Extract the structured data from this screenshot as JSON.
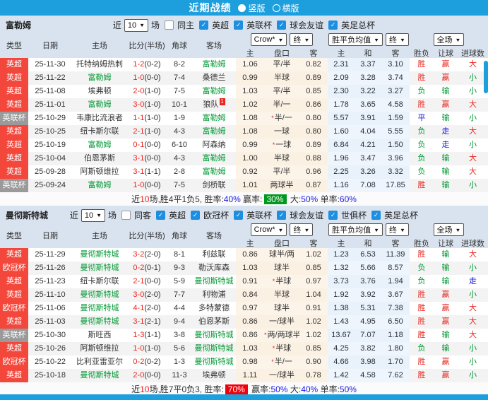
{
  "colors": {
    "accent_blue": "#1d9fdd",
    "badge_red": "#f4473c",
    "badge_gray": "#9a9a9a",
    "team_green": "#009933",
    "score_red": "#e8251f",
    "link_blue": "#1a1ae6",
    "box_green": "#00991f",
    "box_red": "#f2000c",
    "odds_bg": "#fcf4e9",
    "avg_bg": "#e9f2fb"
  },
  "titlebar": {
    "title": "近期战绩",
    "radios": [
      {
        "label": "竖版",
        "selected": true
      },
      {
        "label": "横版",
        "selected": false
      }
    ]
  },
  "columns": {
    "left": [
      "类型",
      "日期",
      "主场",
      "比分(半场)",
      "角球",
      "客场"
    ],
    "odds_sub": [
      "主",
      "盘口",
      "客"
    ],
    "avg_sub": [
      "主",
      "和",
      "客"
    ],
    "results": [
      "胜负",
      "让球",
      "进球数"
    ]
  },
  "controls": {
    "recent_prefix": "近",
    "recent_count": "10",
    "recent_suffix": "场",
    "odds_company": "Crow*",
    "odds_final": "终",
    "avg_label": "胜平负均值",
    "avg_final": "终",
    "scope": "全场"
  },
  "tables": [
    {
      "team": "富勒姆",
      "same_label": "同主",
      "same_checked": false,
      "leagues": [
        "英超",
        "英联杯",
        "球会友谊",
        "英足总杯"
      ],
      "rows": [
        {
          "lg": "英超",
          "lgc": "red",
          "date": "25-11-30",
          "home": "托特纳姆热刺",
          "hT": false,
          "ft": "1-2",
          "ht": "(0-2)",
          "cn": "8-2",
          "away": "富勒姆",
          "aT": true,
          "bd": "",
          "o1": "1.06",
          "st": false,
          "hd": "平/半",
          "o2": "0.82",
          "m1": "2.31",
          "m2": "3.37",
          "m3": "3.10",
          "r1": "胜",
          "c1": "red",
          "r2": "赢",
          "c2": "red",
          "r3": "大",
          "c3": "red"
        },
        {
          "lg": "英超",
          "lgc": "red",
          "date": "25-11-22",
          "home": "富勒姆",
          "hT": true,
          "ft": "1-0",
          "ht": "(0-0)",
          "cn": "7-4",
          "away": "桑德兰",
          "aT": false,
          "bd": "",
          "o1": "0.99",
          "st": false,
          "hd": "半球",
          "o2": "0.89",
          "m1": "2.09",
          "m2": "3.28",
          "m3": "3.74",
          "r1": "胜",
          "c1": "red",
          "r2": "赢",
          "c2": "red",
          "r3": "小",
          "c3": "green"
        },
        {
          "lg": "英超",
          "lgc": "red",
          "date": "25-11-08",
          "home": "埃弗顿",
          "hT": false,
          "ft": "2-0",
          "ht": "(1-0)",
          "cn": "7-5",
          "away": "富勒姆",
          "aT": true,
          "bd": "",
          "o1": "1.03",
          "st": false,
          "hd": "平/半",
          "o2": "0.85",
          "m1": "2.30",
          "m2": "3.22",
          "m3": "3.27",
          "r1": "负",
          "c1": "green",
          "r2": "输",
          "c2": "green",
          "r3": "小",
          "c3": "green"
        },
        {
          "lg": "英超",
          "lgc": "red",
          "date": "25-11-01",
          "home": "富勒姆",
          "hT": true,
          "ft": "3-0",
          "ht": "(1-0)",
          "cn": "10-1",
          "away": "狼队",
          "aT": false,
          "bd": "1",
          "o1": "1.02",
          "st": false,
          "hd": "半/一",
          "o2": "0.86",
          "m1": "1.78",
          "m2": "3.65",
          "m3": "4.58",
          "r1": "胜",
          "c1": "red",
          "r2": "赢",
          "c2": "red",
          "r3": "大",
          "c3": "red"
        },
        {
          "lg": "英联杯",
          "lgc": "gray",
          "date": "25-10-29",
          "home": "韦康比流浪者",
          "hT": false,
          "ft": "1-1",
          "ht": "(1-0)",
          "cn": "1-9",
          "away": "富勒姆",
          "aT": true,
          "bd": "",
          "o1": "1.08",
          "st": true,
          "hd": "半/一",
          "o2": "0.80",
          "m1": "5.57",
          "m2": "3.91",
          "m3": "1.59",
          "r1": "平",
          "c1": "blue",
          "r2": "输",
          "c2": "green",
          "r3": "小",
          "c3": "green"
        },
        {
          "lg": "英超",
          "lgc": "red",
          "date": "25-10-25",
          "home": "纽卡斯尔联",
          "hT": false,
          "ft": "2-1",
          "ht": "(1-0)",
          "cn": "4-3",
          "away": "富勒姆",
          "aT": true,
          "bd": "",
          "o1": "1.08",
          "st": false,
          "hd": "一球",
          "o2": "0.80",
          "m1": "1.60",
          "m2": "4.04",
          "m3": "5.55",
          "r1": "负",
          "c1": "green",
          "r2": "走",
          "c2": "blue",
          "r3": "大",
          "c3": "red"
        },
        {
          "lg": "英超",
          "lgc": "red",
          "date": "25-10-19",
          "home": "富勒姆",
          "hT": true,
          "ft": "0-1",
          "ht": "(0-0)",
          "cn": "6-10",
          "away": "阿森纳",
          "aT": false,
          "bd": "",
          "o1": "0.99",
          "st": true,
          "hd": "一球",
          "o2": "0.89",
          "m1": "6.84",
          "m2": "4.21",
          "m3": "1.50",
          "r1": "负",
          "c1": "green",
          "r2": "走",
          "c2": "blue",
          "r3": "小",
          "c3": "green"
        },
        {
          "lg": "英超",
          "lgc": "red",
          "date": "25-10-04",
          "home": "伯恩茅斯",
          "hT": false,
          "ft": "3-1",
          "ht": "(0-0)",
          "cn": "4-3",
          "away": "富勒姆",
          "aT": true,
          "bd": "",
          "o1": "1.00",
          "st": false,
          "hd": "半球",
          "o2": "0.88",
          "m1": "1.96",
          "m2": "3.47",
          "m3": "3.96",
          "r1": "负",
          "c1": "green",
          "r2": "输",
          "c2": "green",
          "r3": "大",
          "c3": "red"
        },
        {
          "lg": "英超",
          "lgc": "red",
          "date": "25-09-28",
          "home": "阿斯顿维拉",
          "hT": false,
          "ft": "3-1",
          "ht": "(1-1)",
          "cn": "2-8",
          "away": "富勒姆",
          "aT": true,
          "bd": "",
          "o1": "0.92",
          "st": false,
          "hd": "平/半",
          "o2": "0.96",
          "m1": "2.25",
          "m2": "3.26",
          "m3": "3.32",
          "r1": "负",
          "c1": "green",
          "r2": "输",
          "c2": "green",
          "r3": "大",
          "c3": "red"
        },
        {
          "lg": "英联杯",
          "lgc": "gray",
          "date": "25-09-24",
          "home": "富勒姆",
          "hT": true,
          "ft": "1-0",
          "ht": "(0-0)",
          "cn": "7-5",
          "away": "剑桥联",
          "aT": false,
          "bd": "",
          "o1": "1.01",
          "st": false,
          "hd": "两球半",
          "o2": "0.87",
          "m1": "1.16",
          "m2": "7.08",
          "m3": "17.85",
          "r1": "胜",
          "c1": "red",
          "r2": "输",
          "c2": "green",
          "r3": "小",
          "c3": "green"
        }
      ],
      "summary": [
        [
          "近",
          "d"
        ],
        [
          "10",
          "r"
        ],
        [
          "场,胜4平1负5, 胜率:",
          "d"
        ],
        [
          "40%",
          "b"
        ],
        [
          " 赢率:",
          "d"
        ],
        [
          "30%",
          "gb"
        ],
        [
          " 大:",
          "d"
        ],
        [
          "50%",
          "b"
        ],
        [
          " 单率:",
          "d"
        ],
        [
          "60%",
          "b"
        ]
      ]
    },
    {
      "team": "曼彻斯特城",
      "same_label": "同客",
      "same_checked": false,
      "leagues": [
        "英超",
        "欧冠杯",
        "英联杯",
        "球会友谊",
        "世俱杯",
        "英足总杯"
      ],
      "rows": [
        {
          "lg": "英超",
          "lgc": "red",
          "date": "25-11-29",
          "home": "曼彻斯特城",
          "hT": true,
          "ft": "3-2",
          "ht": "(2-0)",
          "cn": "8-1",
          "away": "利兹联",
          "aT": false,
          "bd": "",
          "o1": "0.86",
          "st": false,
          "hd": "球半/两",
          "o2": "1.02",
          "m1": "1.23",
          "m2": "6.53",
          "m3": "11.39",
          "r1": "胜",
          "c1": "red",
          "r2": "输",
          "c2": "green",
          "r3": "大",
          "c3": "red"
        },
        {
          "lg": "欧冠杯",
          "lgc": "red",
          "date": "25-11-26",
          "home": "曼彻斯特城",
          "hT": true,
          "ft": "0-2",
          "ht": "(0-1)",
          "cn": "9-3",
          "away": "勒沃库森",
          "aT": false,
          "bd": "",
          "o1": "1.03",
          "st": false,
          "hd": "球半",
          "o2": "0.85",
          "m1": "1.32",
          "m2": "5.66",
          "m3": "8.57",
          "r1": "负",
          "c1": "green",
          "r2": "输",
          "c2": "green",
          "r3": "小",
          "c3": "green"
        },
        {
          "lg": "英超",
          "lgc": "red",
          "date": "25-11-23",
          "home": "纽卡斯尔联",
          "hT": false,
          "ft": "2-1",
          "ht": "(0-0)",
          "cn": "5-9",
          "away": "曼彻斯特城",
          "aT": true,
          "bd": "",
          "o1": "0.91",
          "st": true,
          "hd": "半球",
          "o2": "0.97",
          "m1": "3.73",
          "m2": "3.76",
          "m3": "1.94",
          "r1": "负",
          "c1": "green",
          "r2": "输",
          "c2": "green",
          "r3": "走",
          "c3": "blue"
        },
        {
          "lg": "英超",
          "lgc": "red",
          "date": "25-11-10",
          "home": "曼彻斯特城",
          "hT": true,
          "ft": "3-0",
          "ht": "(2-0)",
          "cn": "7-7",
          "away": "利物浦",
          "aT": false,
          "bd": "",
          "o1": "0.84",
          "st": false,
          "hd": "半球",
          "o2": "1.04",
          "m1": "1.92",
          "m2": "3.92",
          "m3": "3.67",
          "r1": "胜",
          "c1": "red",
          "r2": "赢",
          "c2": "red",
          "r3": "小",
          "c3": "green"
        },
        {
          "lg": "欧冠杯",
          "lgc": "red",
          "date": "25-11-06",
          "home": "曼彻斯特城",
          "hT": true,
          "ft": "4-1",
          "ht": "(2-0)",
          "cn": "4-4",
          "away": "多特蒙德",
          "aT": false,
          "bd": "",
          "o1": "0.97",
          "st": false,
          "hd": "球半",
          "o2": "0.91",
          "m1": "1.38",
          "m2": "5.31",
          "m3": "7.38",
          "r1": "胜",
          "c1": "red",
          "r2": "赢",
          "c2": "red",
          "r3": "大",
          "c3": "red"
        },
        {
          "lg": "英超",
          "lgc": "red",
          "date": "25-11-03",
          "home": "曼彻斯特城",
          "hT": true,
          "ft": "3-1",
          "ht": "(2-1)",
          "cn": "9-4",
          "away": "伯恩茅斯",
          "aT": false,
          "bd": "",
          "o1": "0.86",
          "st": false,
          "hd": "一/球半",
          "o2": "1.02",
          "m1": "1.43",
          "m2": "4.95",
          "m3": "6.50",
          "r1": "胜",
          "c1": "red",
          "r2": "赢",
          "c2": "red",
          "r3": "大",
          "c3": "red"
        },
        {
          "lg": "英联杯",
          "lgc": "gray",
          "date": "25-10-30",
          "home": "斯旺西",
          "hT": false,
          "ft": "1-3",
          "ht": "(1-1)",
          "cn": "3-8",
          "away": "曼彻斯特城",
          "aT": true,
          "bd": "",
          "o1": "0.86",
          "st": true,
          "hd": "两/两球半",
          "o2": "1.02",
          "m1": "13.67",
          "m2": "7.07",
          "m3": "1.18",
          "r1": "胜",
          "c1": "red",
          "r2": "输",
          "c2": "green",
          "r3": "大",
          "c3": "red"
        },
        {
          "lg": "英超",
          "lgc": "red",
          "date": "25-10-26",
          "home": "阿斯顿维拉",
          "hT": false,
          "ft": "1-0",
          "ht": "(1-0)",
          "cn": "5-6",
          "away": "曼彻斯特城",
          "aT": true,
          "bd": "",
          "o1": "1.03",
          "st": true,
          "hd": "半球",
          "o2": "0.85",
          "m1": "4.25",
          "m2": "3.82",
          "m3": "1.80",
          "r1": "负",
          "c1": "green",
          "r2": "输",
          "c2": "green",
          "r3": "小",
          "c3": "green"
        },
        {
          "lg": "欧冠杯",
          "lgc": "red",
          "date": "25-10-22",
          "home": "比利亚雷亚尔",
          "hT": false,
          "ft": "0-2",
          "ht": "(0-2)",
          "cn": "1-3",
          "away": "曼彻斯特城",
          "aT": true,
          "bd": "",
          "o1": "0.98",
          "st": true,
          "hd": "半/一",
          "o2": "0.90",
          "m1": "4.66",
          "m2": "3.98",
          "m3": "1.70",
          "r1": "胜",
          "c1": "red",
          "r2": "赢",
          "c2": "red",
          "r3": "小",
          "c3": "green"
        },
        {
          "lg": "英超",
          "lgc": "red",
          "date": "25-10-18",
          "home": "曼彻斯特城",
          "hT": true,
          "ft": "2-0",
          "ht": "(0-0)",
          "cn": "11-3",
          "away": "埃弗顿",
          "aT": false,
          "bd": "",
          "o1": "1.11",
          "st": false,
          "hd": "一/球半",
          "o2": "0.78",
          "m1": "1.42",
          "m2": "4.58",
          "m3": "7.62",
          "r1": "胜",
          "c1": "red",
          "r2": "赢",
          "c2": "red",
          "r3": "小",
          "c3": "green"
        }
      ],
      "summary": [
        [
          "近",
          "d"
        ],
        [
          "10",
          "r"
        ],
        [
          "场,胜7平0负3, 胜率:",
          "d"
        ],
        [
          "70%",
          "rb"
        ],
        [
          " 赢率:",
          "d"
        ],
        [
          "50%",
          "b"
        ],
        [
          " 大:",
          "d"
        ],
        [
          "40%",
          "b"
        ],
        [
          " 单率:",
          "d"
        ],
        [
          "50%",
          "b"
        ]
      ]
    }
  ]
}
